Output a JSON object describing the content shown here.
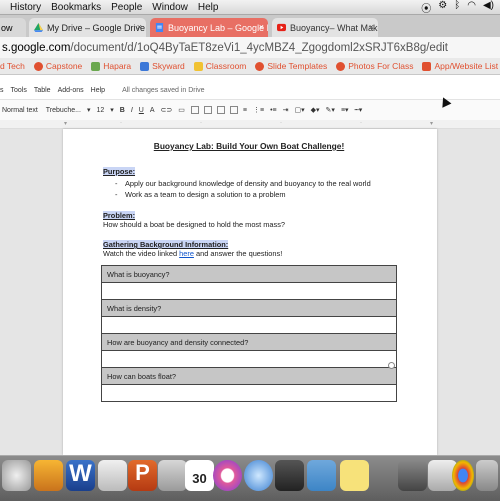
{
  "os_menu": {
    "items": [
      "History",
      "Bookmarks",
      "People",
      "Window",
      "Help"
    ]
  },
  "tabs": [
    {
      "label": "ow"
    },
    {
      "label": "My Drive – Google Drive"
    },
    {
      "label": "Buoyancy Lab – Google Do"
    },
    {
      "label": "Buoyancy– What Makes So"
    }
  ],
  "address": {
    "domain": "s.google.com",
    "path": "/document/d/1oQ4ByTaET8zeVi1_4ycMBZ4_Zgogdoml2xSRJT6xB8g/edit"
  },
  "bookmarks": [
    "d Tech",
    "Capstone",
    "Hapara",
    "Skyward",
    "Classroom",
    "Slide Templates",
    "Photos For Class",
    "App/Website List"
  ],
  "doc_menu": {
    "items": [
      "s",
      "Tools",
      "Table",
      "Add-ons",
      "Help"
    ],
    "saved": "All changes saved in Drive"
  },
  "toolbar": {
    "style": "Normal text",
    "font": "Trebuche...",
    "size": "12",
    "bold": "B",
    "italic": "I",
    "underline": "U"
  },
  "document": {
    "title": "Buoyancy Lab: Build Your Own Boat Challenge!",
    "purpose_heading": "Purpose:",
    "purpose_items": [
      "Apply our background knowledge of density and buoyancy to the real world",
      "Work as a team to design a solution to a problem"
    ],
    "problem_heading": "Problem:",
    "problem_text": "How should a boat be designed to hold the most mass?",
    "background_heading": "Gathering Background Information:",
    "background_before_link": "Watch the video linked ",
    "background_link": "here",
    "background_after_link": " and answer the questions!",
    "questions": [
      "What is buoyancy?",
      "What is density?",
      "How are buoyancy and density connected?",
      "How can boats float?"
    ]
  },
  "dock": {
    "calendar_day": "30"
  },
  "colors": {
    "active_tab": "#e86f64",
    "link": "#1155cc",
    "heading_highlight": "#c9d5f5",
    "table_header": "#c6c6c6"
  }
}
